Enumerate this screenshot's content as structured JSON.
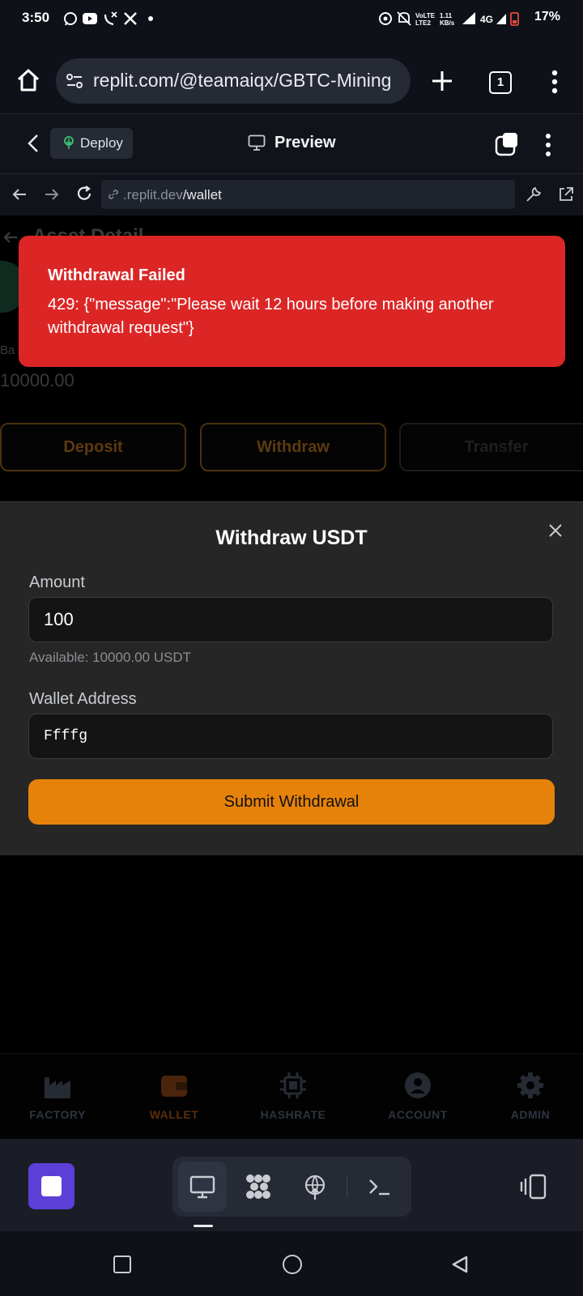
{
  "status_bar": {
    "time": "3:50",
    "left_icons": [
      "whatsapp-icon",
      "youtube-icon",
      "missed-call-icon",
      "x-icon",
      "dot-icon"
    ],
    "network": "4G",
    "battery": "17%"
  },
  "browser": {
    "url": "replit.com/@teamaiqx/GBTC-Mining",
    "tab_count": "1"
  },
  "replit_header": {
    "deploy_label": "Deploy",
    "preview_label": "Preview"
  },
  "preview_nav": {
    "url_domain": ".replit.dev",
    "url_path": "/wallet"
  },
  "page": {
    "title": "Asset Detail",
    "balance_label": "Ba",
    "balance_value": "10000.00",
    "actions": {
      "deposit": "Deposit",
      "withdraw": "Withdraw",
      "transfer": "Transfer"
    }
  },
  "toast": {
    "title": "Withdrawal Failed",
    "message": "429: {\"message\":\"Please wait 12 hours before making another withdrawal request\"}"
  },
  "modal": {
    "title": "Withdraw USDT",
    "amount_label": "Amount",
    "amount_value": "100",
    "available_text": "Available: 10000.00 USDT",
    "wallet_label": "Wallet Address",
    "wallet_value": "Ffffg",
    "submit_label": "Submit Withdrawal"
  },
  "app_nav": {
    "items": [
      {
        "label": "FACTORY",
        "icon": "factory-icon"
      },
      {
        "label": "WALLET",
        "icon": "wallet-icon"
      },
      {
        "label": "HASHRATE",
        "icon": "chip-icon"
      },
      {
        "label": "ACCOUNT",
        "icon": "account-icon"
      },
      {
        "label": "ADMIN",
        "icon": "gear-icon"
      }
    ],
    "active": "WALLET"
  },
  "colors": {
    "toast_bg": "#dc2626",
    "submit_bg": "#e6820a",
    "stop_button": "#5b3fd6"
  }
}
